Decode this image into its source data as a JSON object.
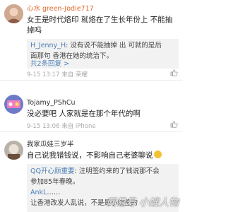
{
  "comments": [
    {
      "username": "心水 green-Jodie717",
      "text_line1": "女王是时代烙印 就烙在了生长年份上 不能抽",
      "text_line2": "掉吗",
      "replies": [
        {
          "user": "H_Jenny_H",
          "text": ": 没有说不能抽掉 出 可就的是后"
        },
        {
          "user": "",
          "text": "面那句 香港在她的统治下。"
        }
      ],
      "reply_more": "共2条回复 >",
      "meta": "9-15 13:17 来自 荣耀"
    },
    {
      "username": "Tojamy_PShCu",
      "text_line1": "没必要吧 人家就是在那个年代的啊",
      "meta": "9-15 13:06 来自 iPhone"
    },
    {
      "username": "我家瓜娃三岁半",
      "text_line1": "自己说我错钱说，不影响自己老婆聊说",
      "replies": [
        {
          "user": "QQ开心颜重要",
          "text": ": 注明签约来的了钱说那不会"
        },
        {
          "user": "",
          "text": "参加85年春晚。"
        },
        {
          "user": "AnkL",
          "text": "……"
        },
        {
          "user": "",
          "text": "让香港改发人乱说，不是是小嫂签的"
        }
      ]
    }
  ],
  "watermark": "网易号 小嫂人物",
  "colors": {
    "accent": "#e06a2b",
    "link": "#4a7eb6",
    "muted": "#a9a9a9"
  }
}
